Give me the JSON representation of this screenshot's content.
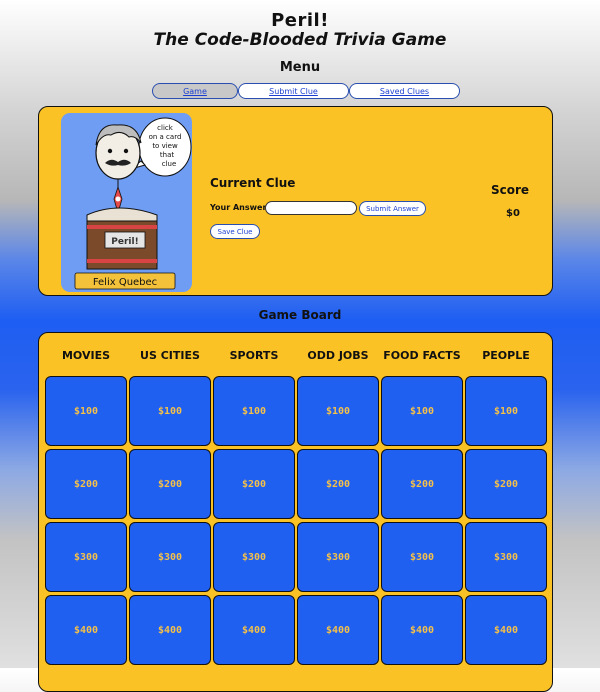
{
  "header": {
    "title": "Peril!",
    "subtitle": "The Code-Blooded Trivia Game",
    "menu_title": "Menu"
  },
  "nav": {
    "game": "Game",
    "submit_clue": "Submit Clue",
    "saved_clues": "Saved Clues"
  },
  "host_card": {
    "speech": [
      "click",
      "on a card",
      "to view",
      "that",
      "clue"
    ],
    "podium_label": "Peril!",
    "name": "Felix Quebec"
  },
  "clue_panel": {
    "current_clue_label": "Current Clue",
    "answer_label": "Your Answer:",
    "answer_value": "",
    "answer_placeholder": "",
    "submit_answer_label": "Submit Answer",
    "save_clue_label": "Save Clue",
    "score_label": "Score",
    "score_value": "$0"
  },
  "board": {
    "title": "Game Board",
    "categories": [
      "MOVIES",
      "US CITIES",
      "SPORTS",
      "ODD JOBS",
      "FOOD FACTS",
      "PEOPLE"
    ],
    "values": [
      "$100",
      "$200",
      "$300",
      "$400"
    ]
  },
  "colors": {
    "panel": "#fbc226",
    "tile": "#2060f0",
    "tile_text": "#f3c04a",
    "card": "#6f9df4"
  }
}
